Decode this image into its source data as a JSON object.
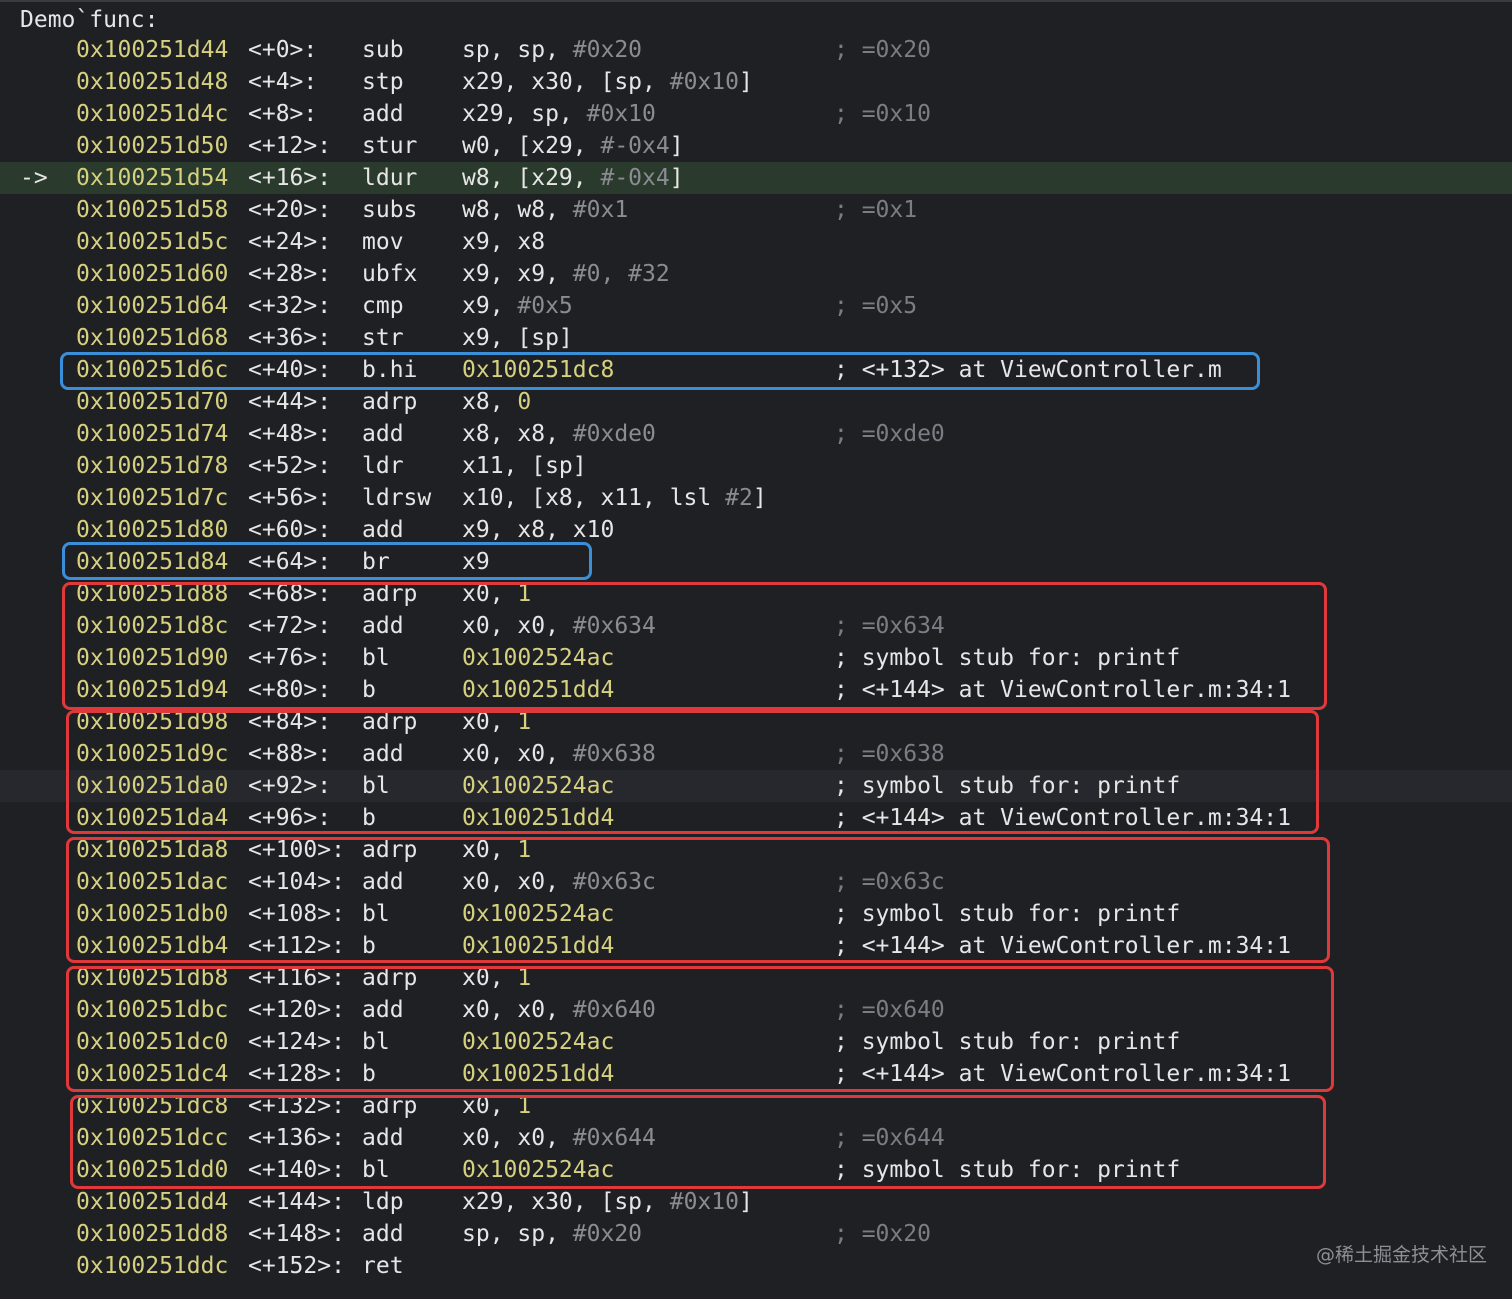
{
  "title": "Demo`func:",
  "watermark": "@稀土掘金技术社区",
  "colors": {
    "background": "#1f2024",
    "address": "#d6d17f",
    "current_line": "#2a3a2c",
    "highlight_blue": "#3b8fd9",
    "highlight_red": "#e0393b"
  },
  "lines": [
    {
      "addr": "0x100251d44",
      "off": "<+0>:",
      "mn": "sub",
      "ops": [
        [
          "sp, sp, ",
          "t"
        ],
        [
          "#0x20",
          "imm"
        ]
      ],
      "cmt": "; =0x20",
      "cmt_dim": true
    },
    {
      "addr": "0x100251d48",
      "off": "<+4>:",
      "mn": "stp",
      "ops": [
        [
          "x29, x30, [sp, ",
          "t"
        ],
        [
          "#0x10",
          "imm"
        ],
        [
          "]",
          "t"
        ]
      ],
      "cmt": "",
      "cmt_dim": false
    },
    {
      "addr": "0x100251d4c",
      "off": "<+8>:",
      "mn": "add",
      "ops": [
        [
          "x29, sp, ",
          "t"
        ],
        [
          "#0x10",
          "imm"
        ]
      ],
      "cmt": "; =0x10",
      "cmt_dim": true
    },
    {
      "addr": "0x100251d50",
      "off": "<+12>:",
      "mn": "stur",
      "ops": [
        [
          "w0, [x29, ",
          "t"
        ],
        [
          "#-0x4",
          "imm"
        ],
        [
          "]",
          "t"
        ]
      ],
      "cmt": "",
      "cmt_dim": false
    },
    {
      "addr": "0x100251d54",
      "off": "<+16>:",
      "mn": "ldur",
      "ops": [
        [
          "w8, [x29, ",
          "t"
        ],
        [
          "#-0x4",
          "imm"
        ],
        [
          "]",
          "t"
        ]
      ],
      "cmt": "",
      "cmt_dim": false,
      "current": true,
      "arrow": "->"
    },
    {
      "addr": "0x100251d58",
      "off": "<+20>:",
      "mn": "subs",
      "ops": [
        [
          "w8, w8, ",
          "t"
        ],
        [
          "#0x1",
          "imm"
        ]
      ],
      "cmt": "; =0x1",
      "cmt_dim": true
    },
    {
      "addr": "0x100251d5c",
      "off": "<+24>:",
      "mn": "mov",
      "ops": [
        [
          "x9, x8",
          "t"
        ]
      ],
      "cmt": "",
      "cmt_dim": false
    },
    {
      "addr": "0x100251d60",
      "off": "<+28>:",
      "mn": "ubfx",
      "ops": [
        [
          "x9, x9, ",
          "t"
        ],
        [
          "#0, #32",
          "imm"
        ]
      ],
      "cmt": "",
      "cmt_dim": false
    },
    {
      "addr": "0x100251d64",
      "off": "<+32>:",
      "mn": "cmp",
      "ops": [
        [
          "x9, ",
          "t"
        ],
        [
          "#0x5",
          "imm"
        ]
      ],
      "cmt": "; =0x5",
      "cmt_dim": true
    },
    {
      "addr": "0x100251d68",
      "off": "<+36>:",
      "mn": "str",
      "ops": [
        [
          "x9, [sp]",
          "t"
        ]
      ],
      "cmt": "",
      "cmt_dim": false
    },
    {
      "addr": "0x100251d6c",
      "off": "<+40>:",
      "mn": "b.hi",
      "ops": [
        [
          "0x100251dc8",
          "num"
        ]
      ],
      "cmt": "; <+132> at ViewController.m",
      "cmt_dim": false
    },
    {
      "addr": "0x100251d70",
      "off": "<+44>:",
      "mn": "adrp",
      "ops": [
        [
          "x8, ",
          "t"
        ],
        [
          "0",
          "num"
        ]
      ],
      "cmt": "",
      "cmt_dim": false
    },
    {
      "addr": "0x100251d74",
      "off": "<+48>:",
      "mn": "add",
      "ops": [
        [
          "x8, x8, ",
          "t"
        ],
        [
          "#0xde0",
          "imm"
        ]
      ],
      "cmt": "; =0xde0",
      "cmt_dim": true
    },
    {
      "addr": "0x100251d78",
      "off": "<+52>:",
      "mn": "ldr",
      "ops": [
        [
          "x11, [sp]",
          "t"
        ]
      ],
      "cmt": "",
      "cmt_dim": false
    },
    {
      "addr": "0x100251d7c",
      "off": "<+56>:",
      "mn": "ldrsw",
      "ops": [
        [
          "x10, [x8, x11, lsl ",
          "t"
        ],
        [
          "#2",
          "imm"
        ],
        [
          "]",
          "t"
        ]
      ],
      "cmt": "",
      "cmt_dim": false
    },
    {
      "addr": "0x100251d80",
      "off": "<+60>:",
      "mn": "add",
      "ops": [
        [
          "x9, x8, x10",
          "t"
        ]
      ],
      "cmt": "",
      "cmt_dim": false
    },
    {
      "addr": "0x100251d84",
      "off": "<+64>:",
      "mn": "br",
      "ops": [
        [
          "x9",
          "t"
        ]
      ],
      "cmt": "",
      "cmt_dim": false
    },
    {
      "addr": "0x100251d88",
      "off": "<+68>:",
      "mn": "adrp",
      "ops": [
        [
          "x0, ",
          "t"
        ],
        [
          "1",
          "num"
        ]
      ],
      "cmt": "",
      "cmt_dim": false
    },
    {
      "addr": "0x100251d8c",
      "off": "<+72>:",
      "mn": "add",
      "ops": [
        [
          "x0, x0, ",
          "t"
        ],
        [
          "#0x634",
          "imm"
        ]
      ],
      "cmt": "; =0x634",
      "cmt_dim": true
    },
    {
      "addr": "0x100251d90",
      "off": "<+76>:",
      "mn": "bl",
      "ops": [
        [
          "0x1002524ac",
          "num"
        ]
      ],
      "cmt": "; symbol stub for: printf",
      "cmt_dim": false
    },
    {
      "addr": "0x100251d94",
      "off": "<+80>:",
      "mn": "b",
      "ops": [
        [
          "0x100251dd4",
          "num"
        ]
      ],
      "cmt": "; <+144> at ViewController.m:34:1",
      "cmt_dim": false
    },
    {
      "addr": "0x100251d98",
      "off": "<+84>:",
      "mn": "adrp",
      "ops": [
        [
          "x0, ",
          "t"
        ],
        [
          "1",
          "num"
        ]
      ],
      "cmt": "",
      "cmt_dim": false
    },
    {
      "addr": "0x100251d9c",
      "off": "<+88>:",
      "mn": "add",
      "ops": [
        [
          "x0, x0, ",
          "t"
        ],
        [
          "#0x638",
          "imm"
        ]
      ],
      "cmt": "; =0x638",
      "cmt_dim": true
    },
    {
      "addr": "0x100251da0",
      "off": "<+92>:",
      "mn": "bl",
      "ops": [
        [
          "0x1002524ac",
          "num"
        ]
      ],
      "cmt": "; symbol stub for: printf",
      "cmt_dim": false,
      "hover": true
    },
    {
      "addr": "0x100251da4",
      "off": "<+96>:",
      "mn": "b",
      "ops": [
        [
          "0x100251dd4",
          "num"
        ]
      ],
      "cmt": "; <+144> at ViewController.m:34:1",
      "cmt_dim": false
    },
    {
      "addr": "0x100251da8",
      "off": "<+100>:",
      "mn": "adrp",
      "ops": [
        [
          "x0, ",
          "t"
        ],
        [
          "1",
          "num"
        ]
      ],
      "cmt": "",
      "cmt_dim": false
    },
    {
      "addr": "0x100251dac",
      "off": "<+104>:",
      "mn": "add",
      "ops": [
        [
          "x0, x0, ",
          "t"
        ],
        [
          "#0x63c",
          "imm"
        ]
      ],
      "cmt": "; =0x63c",
      "cmt_dim": true
    },
    {
      "addr": "0x100251db0",
      "off": "<+108>:",
      "mn": "bl",
      "ops": [
        [
          "0x1002524ac",
          "num"
        ]
      ],
      "cmt": "; symbol stub for: printf",
      "cmt_dim": false
    },
    {
      "addr": "0x100251db4",
      "off": "<+112>:",
      "mn": "b",
      "ops": [
        [
          "0x100251dd4",
          "num"
        ]
      ],
      "cmt": "; <+144> at ViewController.m:34:1",
      "cmt_dim": false
    },
    {
      "addr": "0x100251db8",
      "off": "<+116>:",
      "mn": "adrp",
      "ops": [
        [
          "x0, ",
          "t"
        ],
        [
          "1",
          "num"
        ]
      ],
      "cmt": "",
      "cmt_dim": false
    },
    {
      "addr": "0x100251dbc",
      "off": "<+120>:",
      "mn": "add",
      "ops": [
        [
          "x0, x0, ",
          "t"
        ],
        [
          "#0x640",
          "imm"
        ]
      ],
      "cmt": "; =0x640",
      "cmt_dim": true
    },
    {
      "addr": "0x100251dc0",
      "off": "<+124>:",
      "mn": "bl",
      "ops": [
        [
          "0x1002524ac",
          "num"
        ]
      ],
      "cmt": "; symbol stub for: printf",
      "cmt_dim": false
    },
    {
      "addr": "0x100251dc4",
      "off": "<+128>:",
      "mn": "b",
      "ops": [
        [
          "0x100251dd4",
          "num"
        ]
      ],
      "cmt": "; <+144> at ViewController.m:34:1",
      "cmt_dim": false
    },
    {
      "addr": "0x100251dc8",
      "off": "<+132>:",
      "mn": "adrp",
      "ops": [
        [
          "x0, ",
          "t"
        ],
        [
          "1",
          "num"
        ]
      ],
      "cmt": "",
      "cmt_dim": false
    },
    {
      "addr": "0x100251dcc",
      "off": "<+136>:",
      "mn": "add",
      "ops": [
        [
          "x0, x0, ",
          "t"
        ],
        [
          "#0x644",
          "imm"
        ]
      ],
      "cmt": "; =0x644",
      "cmt_dim": true
    },
    {
      "addr": "0x100251dd0",
      "off": "<+140>:",
      "mn": "bl",
      "ops": [
        [
          "0x1002524ac",
          "num"
        ]
      ],
      "cmt": "; symbol stub for: printf",
      "cmt_dim": false
    },
    {
      "addr": "0x100251dd4",
      "off": "<+144>:",
      "mn": "ldp",
      "ops": [
        [
          "x29, x30, [sp, ",
          "t"
        ],
        [
          "#0x10",
          "imm"
        ],
        [
          "]",
          "t"
        ]
      ],
      "cmt": "",
      "cmt_dim": false
    },
    {
      "addr": "0x100251dd8",
      "off": "<+148>:",
      "mn": "add",
      "ops": [
        [
          "sp, sp, ",
          "t"
        ],
        [
          "#0x20",
          "imm"
        ]
      ],
      "cmt": "; =0x20",
      "cmt_dim": true
    },
    {
      "addr": "0x100251ddc",
      "off": "<+152>:",
      "mn": "ret",
      "ops": [],
      "cmt": "",
      "cmt_dim": false
    }
  ],
  "highlights": {
    "blue_first_line": "0x100251d6c",
    "red_groups": [
      "0x100251d88",
      "0x100251d98",
      "0x100251da8",
      "0x100251db8",
      "0x100251dc8"
    ]
  }
}
